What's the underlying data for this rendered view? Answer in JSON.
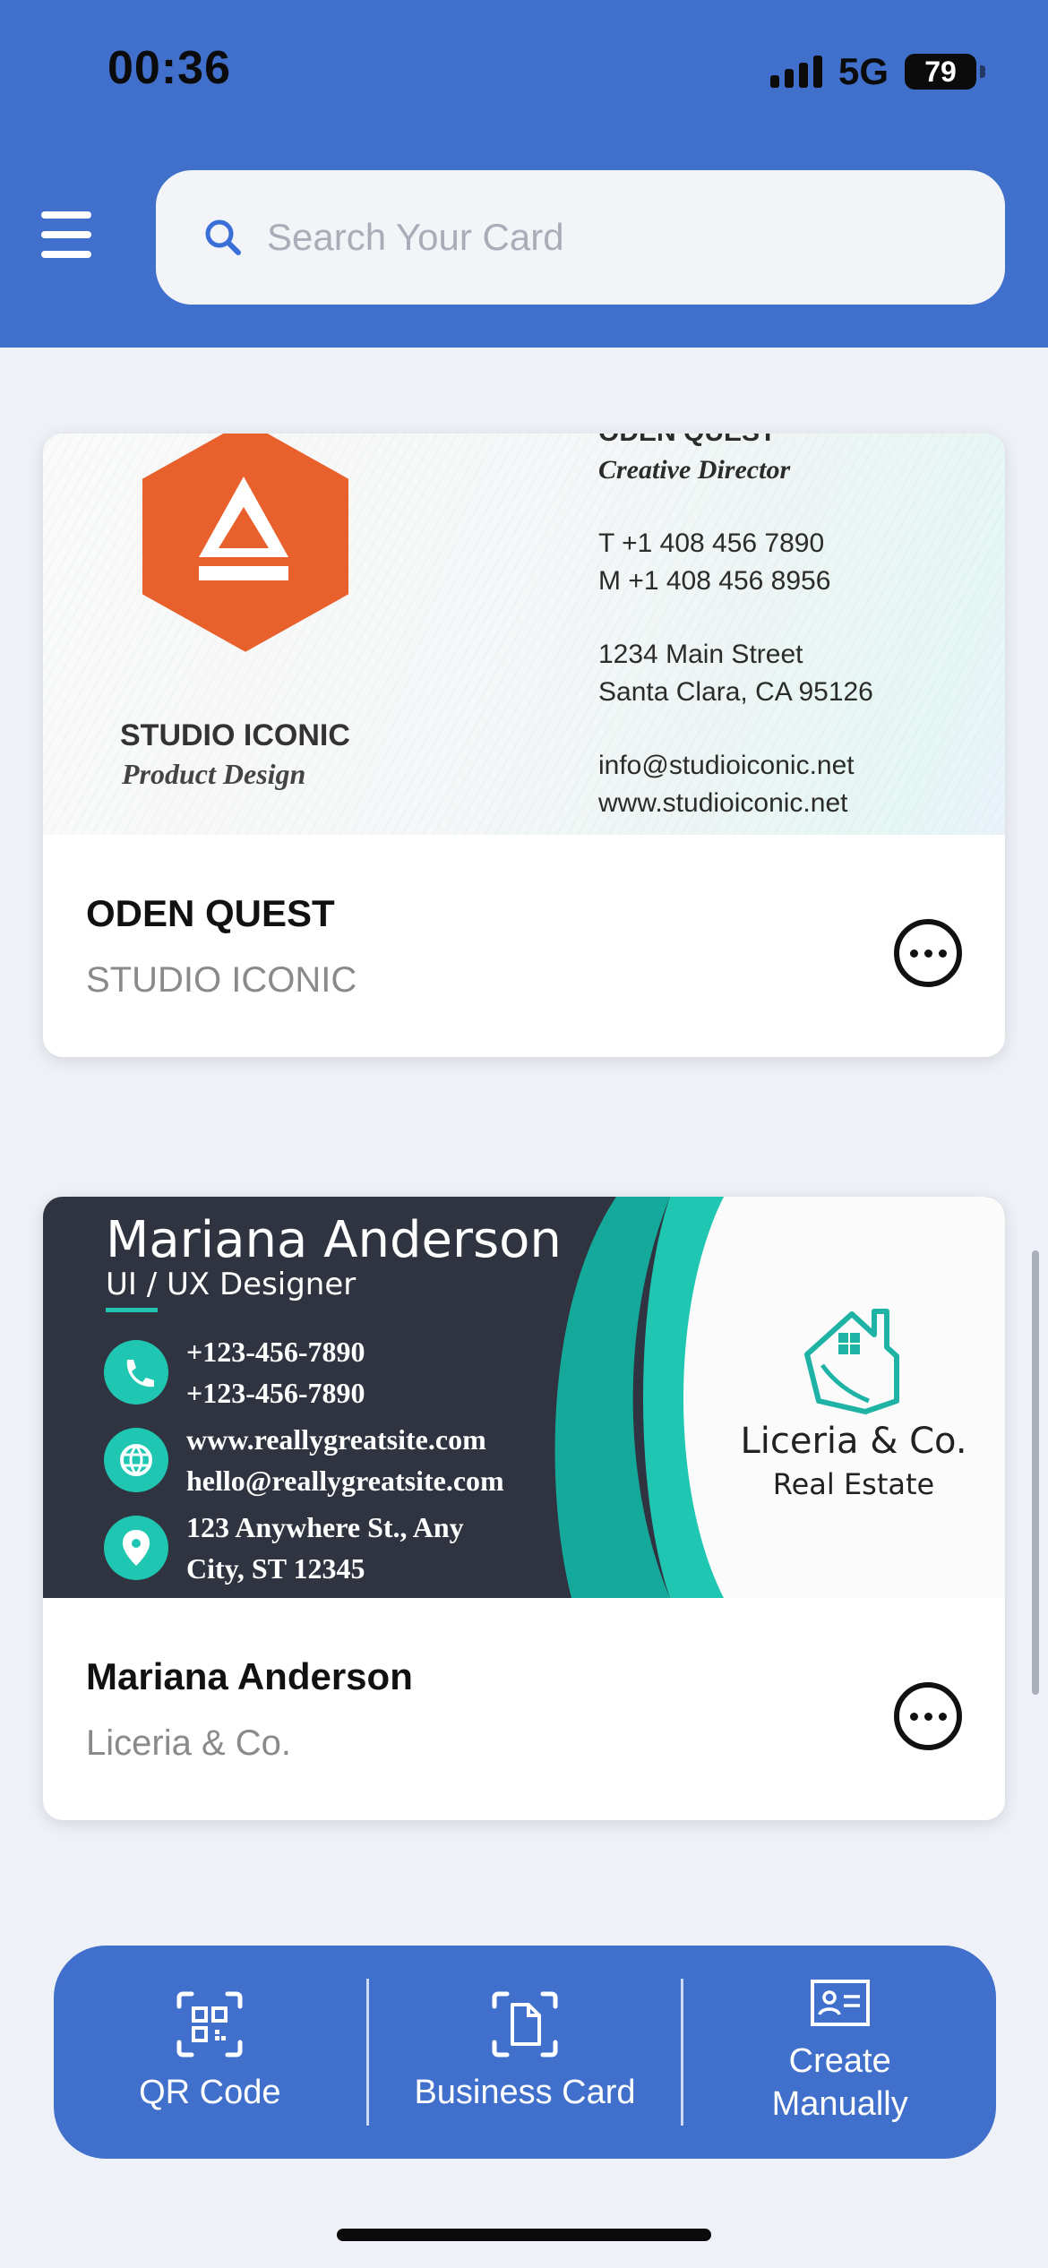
{
  "status_bar": {
    "time": "00:36",
    "network": "5G",
    "battery": "79"
  },
  "header": {
    "search_placeholder": "Search Your Card"
  },
  "cards": [
    {
      "name": "ODEN QUEST",
      "company": "STUDIO ICONIC",
      "artwork": {
        "brand": "STUDIO ICONIC",
        "tagline": "Product Design",
        "top_cut_text": "ODEN QUEST",
        "role": "Creative Director",
        "phone_t": "T     +1 408 456 7890",
        "phone_m": "M    +1 408 456 8956",
        "address1": "1234 Main Street",
        "address2": "Santa Clara, CA 95126",
        "email": "info@studioiconic.net",
        "web": "www.studioiconic.net",
        "brand_color": "#e8612d"
      }
    },
    {
      "name": "Mariana Anderson",
      "company": "Liceria & Co.",
      "artwork": {
        "name": "Mariana Anderson",
        "role": "UI / UX Designer",
        "phone1": "+123-456-7890",
        "phone2": "+123-456-7890",
        "web": "www.reallygreatsite.com",
        "email": "hello@reallygreatsite.com",
        "address1": "123 Anywhere St., Any",
        "address2": "City, ST 12345",
        "logo_name": "Liceria & Co.",
        "logo_sub": "Real Estate",
        "accent_color": "#1fc7b2",
        "dark_color": "#2f3440"
      }
    }
  ],
  "bottom_bar": {
    "qr_label": "QR Code",
    "business_label": "Business Card",
    "create_label": "Create\nManually"
  },
  "colors": {
    "primary": "#4170cc",
    "background": "#eff1f8"
  }
}
